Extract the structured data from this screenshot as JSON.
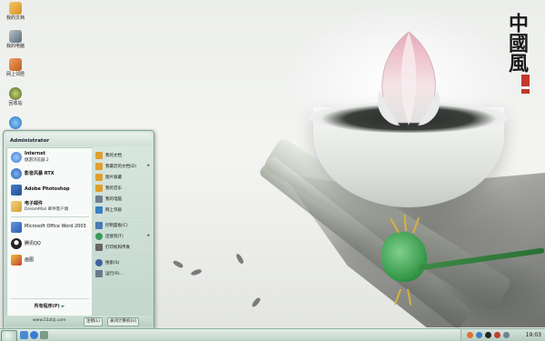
{
  "wallpaper": {
    "calligraphy": "中國風"
  },
  "desktop_icons": [
    {
      "label": "我的文档",
      "color": "#e0a030"
    },
    {
      "label": "我的电脑",
      "color": "#708090"
    },
    {
      "label": "网上邻居",
      "color": "#d07030"
    },
    {
      "label": "回收站",
      "color": "#6a8a3a"
    },
    {
      "label": "",
      "color": "#2a7fd4"
    }
  ],
  "start_menu": {
    "user": "Administrator",
    "pinned": [
      {
        "title": "Internet",
        "subtitle": "傲游浏览器 2",
        "icon": "browser-icon",
        "color": "#3a7bd5"
      },
      {
        "title": "影音风暴 RTX",
        "subtitle": "",
        "icon": "media-player-icon",
        "color": "#2860b0"
      },
      {
        "title": "Adobe Photoshop",
        "subtitle": "",
        "icon": "photoshop-icon",
        "color": "#1f4f8f"
      },
      {
        "title": "电子邮件",
        "subtitle": "DreamMail 邮件客户端",
        "icon": "mail-icon",
        "color": "#d8a030"
      }
    ],
    "recent": [
      {
        "label": "Microsoft Office Word 2003",
        "icon": "word-icon",
        "color": "#2a5db0"
      },
      {
        "label": "腾讯QQ",
        "icon": "qq-icon",
        "color": "#222222"
      },
      {
        "label": "画图",
        "icon": "paint-icon",
        "color": "#c04030"
      }
    ],
    "all_programs": "所有程序(P)",
    "right_items": [
      {
        "label": "我的文档",
        "icon": "folder-icon",
        "color": "#e0a030",
        "arrow": false
      },
      {
        "label": "我最近的文档(D)",
        "icon": "recent-docs-icon",
        "color": "#e0a030",
        "arrow": true
      },
      {
        "label": "图片收藏",
        "icon": "pictures-icon",
        "color": "#e0a030",
        "arrow": false
      },
      {
        "label": "我的音乐",
        "icon": "music-icon",
        "color": "#e0a030",
        "arrow": false
      },
      {
        "label": "我的电脑",
        "icon": "computer-icon",
        "color": "#708090",
        "arrow": false
      },
      {
        "label": "网上邻居",
        "icon": "network-icon",
        "color": "#3a80c0",
        "arrow": false
      },
      {
        "label": "控制面板(C)",
        "icon": "control-panel-icon",
        "color": "#4a7ab0",
        "arrow": false
      },
      {
        "label": "连接到(T)",
        "icon": "connect-icon",
        "color": "#3a9a5a",
        "arrow": true
      },
      {
        "label": "打印机和传真",
        "icon": "printer-icon",
        "color": "#666666",
        "arrow": false
      },
      {
        "label": "搜索(S)",
        "icon": "search-icon",
        "color": "#4060a0",
        "arrow": false
      },
      {
        "label": "运行(R)...",
        "icon": "run-icon",
        "color": "#6a7a8a",
        "arrow": false
      }
    ],
    "footer": {
      "url": "www.51ztzj.com",
      "logoff": "注销(L)",
      "shutdown": "关闭计算机(U)"
    }
  },
  "taskbar": {
    "clock": "19:03"
  }
}
